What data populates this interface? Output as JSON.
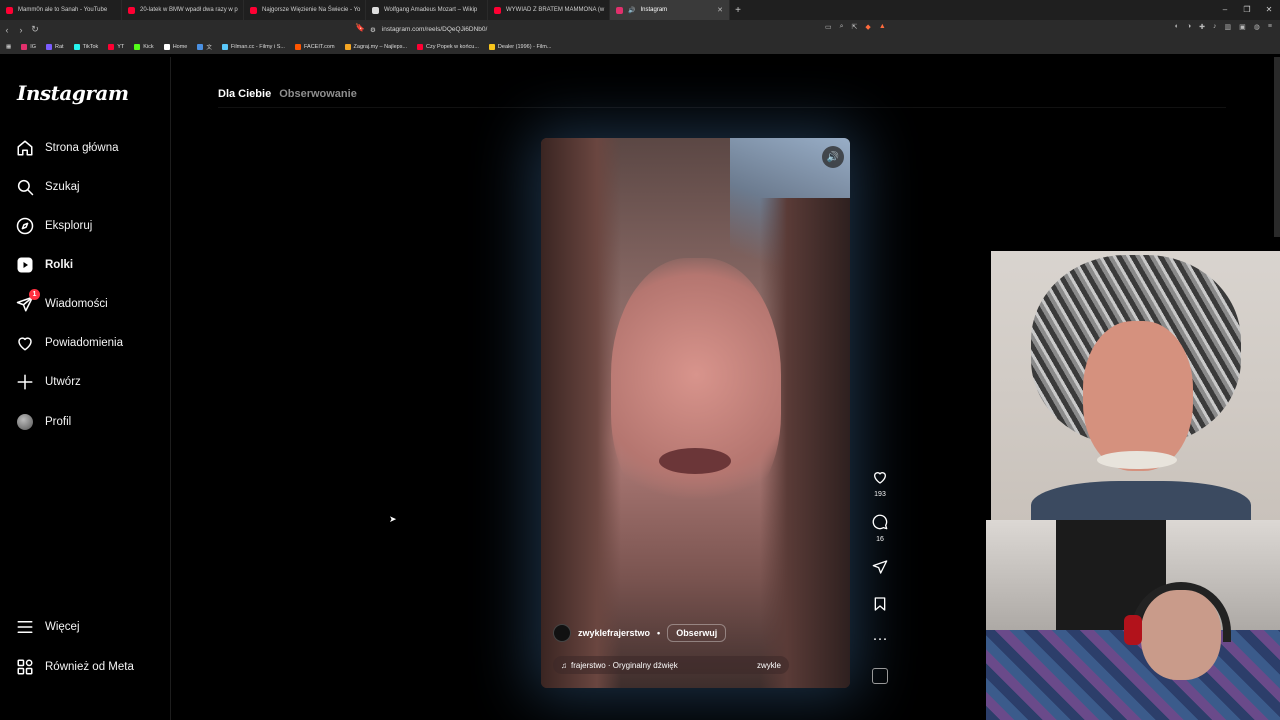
{
  "browser": {
    "tabs": [
      {
        "title": "Mamm0n ale to Sanah - YouTube",
        "color": "#ff0033"
      },
      {
        "title": "20-latek w BMW wpadł dwa razy w p",
        "color": "#ff0033"
      },
      {
        "title": "Najgorsze Więzienie Na Świecie - Yo",
        "color": "#ff0033"
      },
      {
        "title": "Wolfgang Amadeus Mozart – Wikip",
        "color": "#dddddd"
      },
      {
        "title": "WYWIAD Z BRATEM MAMMONA (w",
        "color": "#ff0033"
      },
      {
        "title": "Instagram",
        "color": "#e1306c"
      }
    ],
    "url": "instagram.com/reels/DQeQJi6DNb0/",
    "bookmarks": [
      {
        "label": "IG",
        "color": "#e1306c"
      },
      {
        "label": "Rat",
        "color": "#7b5cff"
      },
      {
        "label": "TikTok",
        "color": "#25f4ee"
      },
      {
        "label": "YT",
        "color": "#ff0033"
      },
      {
        "label": "Kick",
        "color": "#53fc18"
      },
      {
        "label": "Home",
        "color": "#ffffff"
      },
      {
        "label": "文",
        "color": "#4a90e2"
      },
      {
        "label": "Filman.cc - Filmy i S...",
        "color": "#5ac8fa"
      },
      {
        "label": "FACEIT.com",
        "color": "#ff5500"
      },
      {
        "label": "Zagraj.my – Najleps...",
        "color": "#f5a623"
      },
      {
        "label": "Czy Popek w końcu...",
        "color": "#ff0033"
      },
      {
        "label": "Dealer (1996) - Film...",
        "color": "#f8c51c"
      }
    ]
  },
  "sidebar": {
    "logo": "Instagram",
    "items": [
      {
        "label": "Strona główna",
        "icon": "home-icon"
      },
      {
        "label": "Szukaj",
        "icon": "search-icon"
      },
      {
        "label": "Eksploruj",
        "icon": "compass-icon"
      },
      {
        "label": "Rolki",
        "icon": "reels-icon"
      },
      {
        "label": "Wiadomości",
        "icon": "messages-icon",
        "badge": "1"
      },
      {
        "label": "Powiadomienia",
        "icon": "heart-icon"
      },
      {
        "label": "Utwórz",
        "icon": "plus-icon"
      },
      {
        "label": "Profil",
        "icon": "avatar"
      }
    ],
    "more": "Więcej",
    "meta": "Również od Meta"
  },
  "feed": {
    "tabs": [
      "Dla Ciebie",
      "Obserwowanie"
    ]
  },
  "reel": {
    "author": "zwyklefrajerstwo",
    "separator": "•",
    "follow": "Obserwuj",
    "audio": "frajerstwo · Oryginalny dźwięk",
    "audio_tail": "zwykle",
    "likes": "193",
    "comments": "16"
  }
}
